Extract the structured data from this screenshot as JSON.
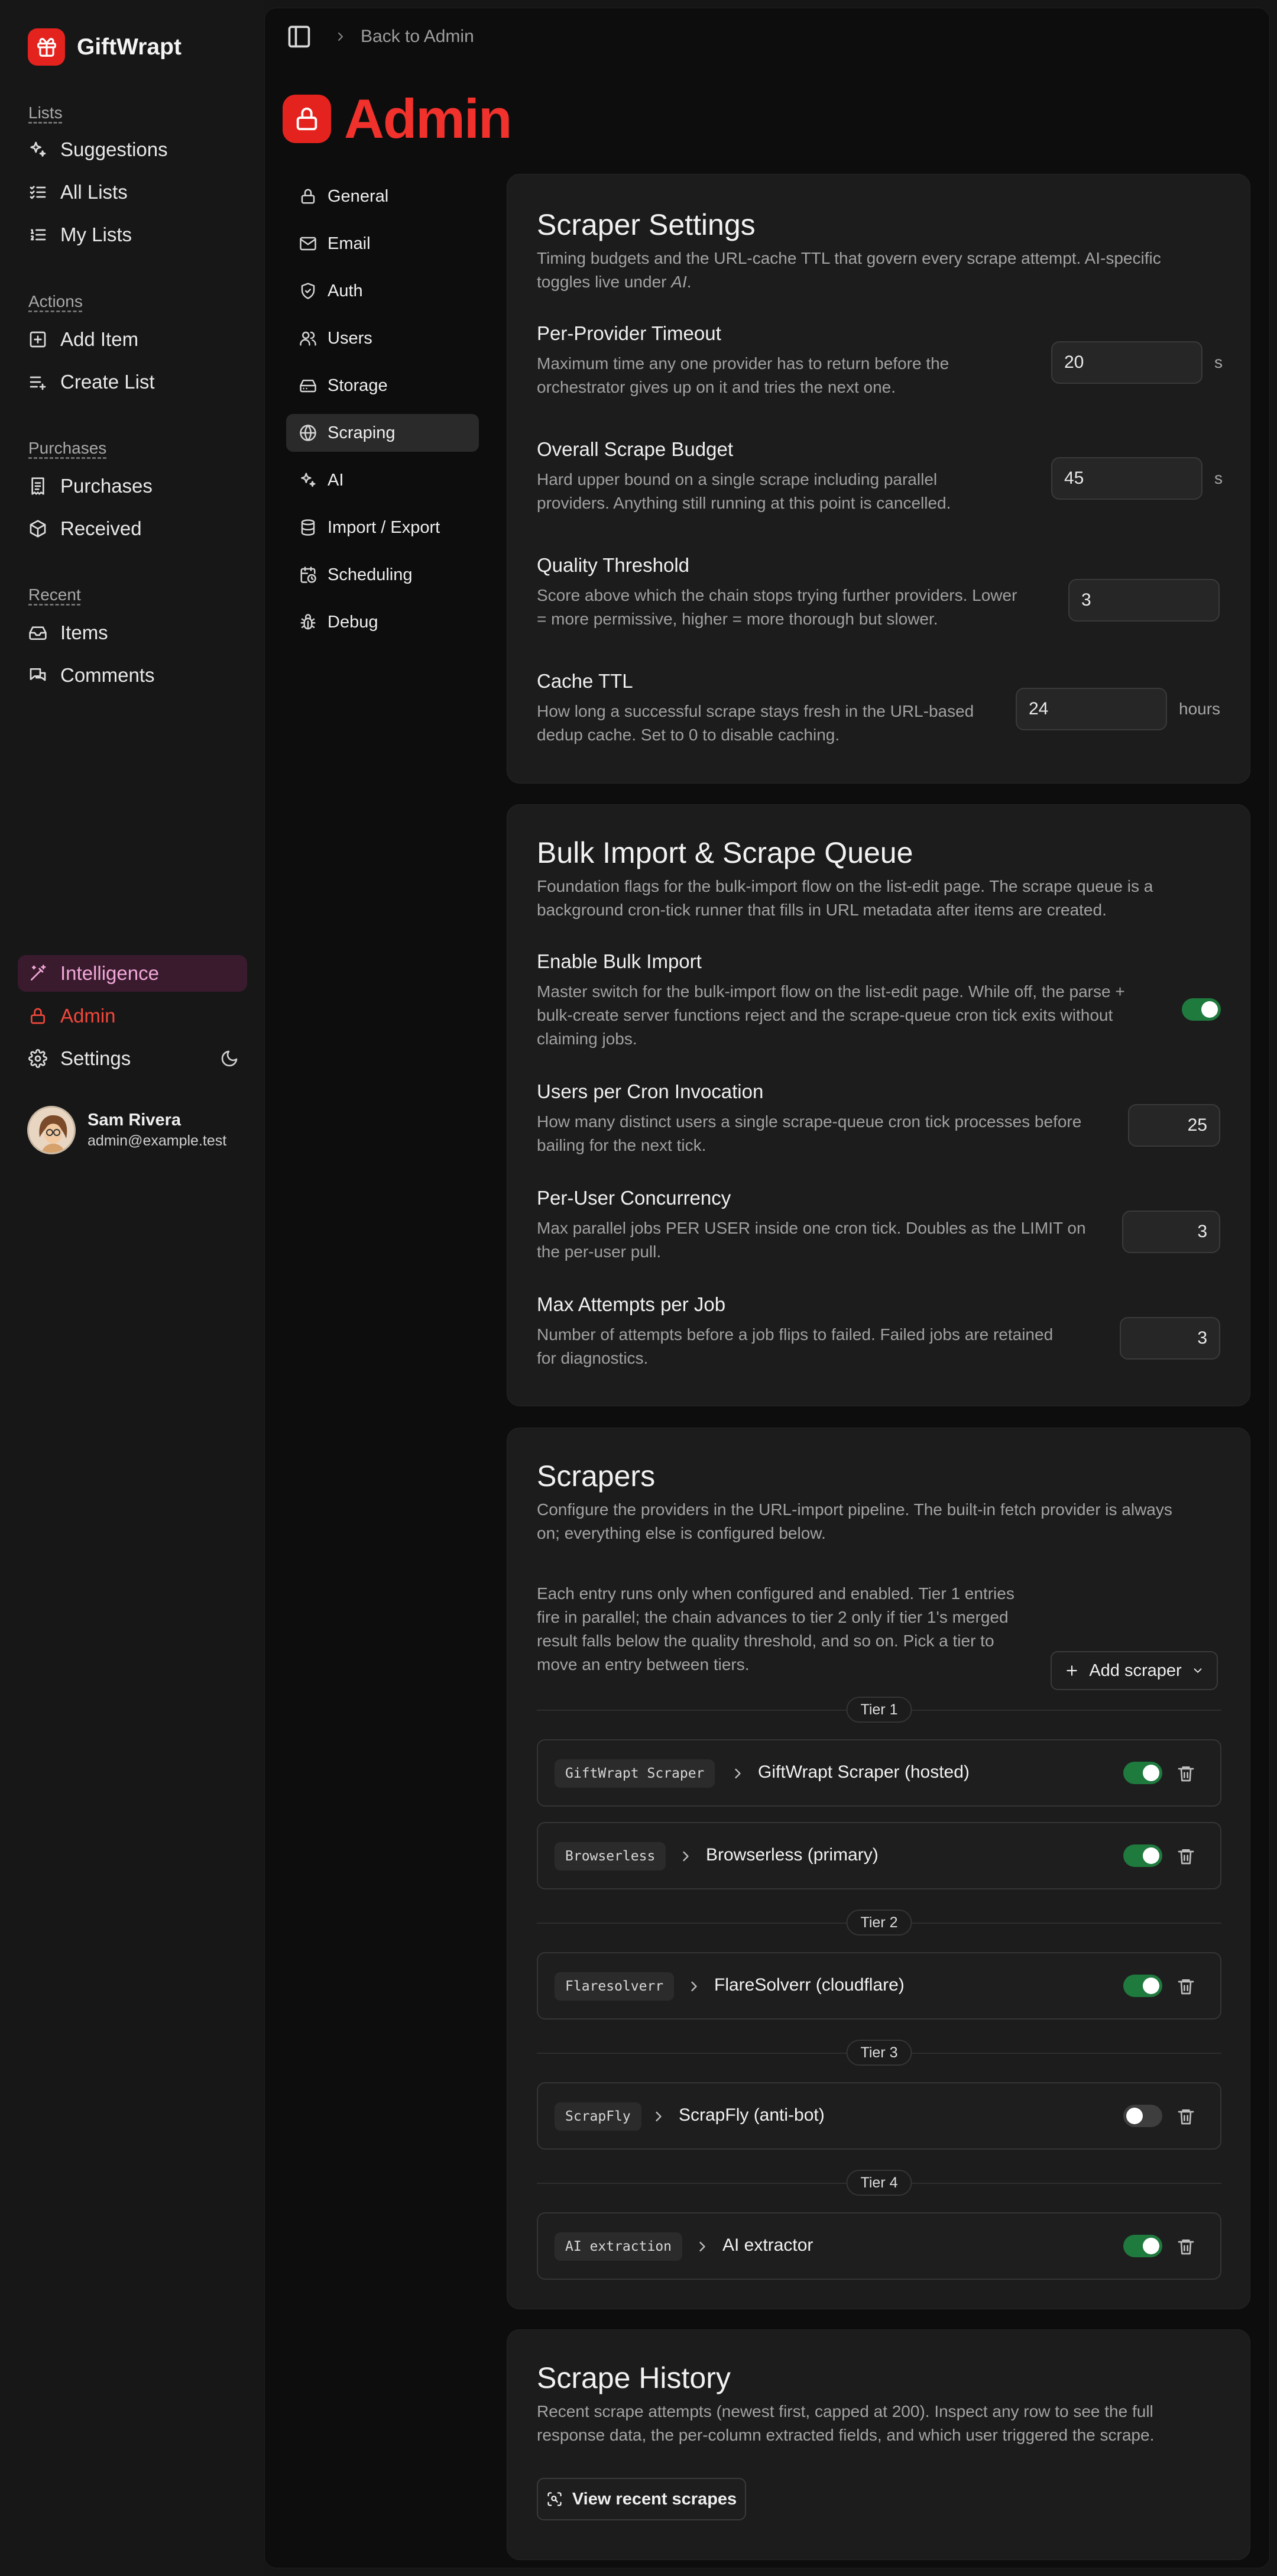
{
  "app": {
    "name": "GiftWrapt"
  },
  "sidebar": {
    "groups": {
      "lists": "Lists",
      "actions": "Actions",
      "purchases": "Purchases",
      "recent": "Recent"
    },
    "items": {
      "suggestions": "Suggestions",
      "all_lists": "All Lists",
      "my_lists": "My Lists",
      "add_item": "Add Item",
      "create_list": "Create List",
      "purchases": "Purchases",
      "received": "Received",
      "items": "Items",
      "comments": "Comments",
      "intelligence": "Intelligence",
      "admin": "Admin",
      "settings": "Settings"
    },
    "user": {
      "name": "Sam Rivera",
      "email": "admin@example.test"
    }
  },
  "header": {
    "breadcrumb": "Back to Admin",
    "title": "Admin"
  },
  "admin_nav": {
    "general": "General",
    "email": "Email",
    "auth": "Auth",
    "users": "Users",
    "storage": "Storage",
    "scraping": "Scraping",
    "ai": "AI",
    "import_export": "Import / Export",
    "scheduling": "Scheduling",
    "debug": "Debug",
    "active": "Scraping"
  },
  "scraper_settings": {
    "title": "Scraper Settings",
    "desc_prefix": "Timing budgets and the URL-cache TTL that govern every scrape attempt. AI-specific toggles live under ",
    "desc_link": "AI",
    "desc_suffix": ".",
    "fields": {
      "timeout": {
        "label": "Per-Provider Timeout",
        "desc1": "Maximum time any one provider has to return before the",
        "desc2": "orchestrator gives up on it and tries the next one.",
        "value": "20",
        "unit": "s"
      },
      "budget": {
        "label": "Overall Scrape Budget",
        "desc1": "Hard upper bound on a single scrape including parallel",
        "desc2": "providers. Anything still running at this point is cancelled.",
        "value": "45",
        "unit": "s"
      },
      "quality": {
        "label": "Quality Threshold",
        "desc1": "Score above which the chain stops trying further providers. Lower",
        "desc2": "= more permissive, higher = more thorough but slower.",
        "value": "3"
      },
      "cache": {
        "label": "Cache TTL",
        "desc1": "How long a successful scrape stays fresh in the URL-based",
        "desc2": "dedup cache. Set to 0 to disable caching.",
        "value": "24",
        "unit": "hours"
      }
    }
  },
  "bulk_import": {
    "title": "Bulk Import & Scrape Queue",
    "desc1": "Foundation flags for the bulk-import flow on the list-edit page. The scrape queue is a",
    "desc2": "background cron-tick runner that fills in URL metadata after items are created.",
    "fields": {
      "enable": {
        "label": "Enable Bulk Import",
        "desc1": "Master switch for the bulk-import flow on the list-edit page. While off, the parse +",
        "desc2": "bulk-create server functions reject and the scrape-queue cron tick exits without",
        "desc3": "claiming jobs.",
        "enabled": true
      },
      "users_per_cron": {
        "label": "Users per Cron Invocation",
        "desc1": "How many distinct users a single scrape-queue cron tick processes before",
        "desc2": "bailing for the next tick.",
        "value": "25"
      },
      "concurrency": {
        "label": "Per-User Concurrency",
        "desc1": "Max parallel jobs PER USER inside one cron tick. Doubles as the LIMIT on",
        "desc2": "the per-user pull.",
        "value": "3"
      },
      "max_attempts": {
        "label": "Max Attempts per Job",
        "desc1": "Number of attempts before a job flips to failed. Failed jobs are retained",
        "desc2": "for diagnostics.",
        "value": "3"
      }
    }
  },
  "scrapers": {
    "title": "Scrapers",
    "desc1": "Configure the providers in the URL-import pipeline. The built-in fetch provider is always",
    "desc2": "on; everything else is configured below.",
    "info1": "Each entry runs only when configured and enabled. Tier 1 entries",
    "info2": "fire in parallel; the chain advances to tier 2 only if tier 1's merged",
    "info3": "result falls below the quality threshold, and so on. Pick a tier to",
    "info4": "move an entry between tiers.",
    "add_label": "Add scraper",
    "tiers": [
      "Tier 1",
      "Tier 2",
      "Tier 3",
      "Tier 4"
    ],
    "entries": [
      {
        "type": "GiftWrapt Scraper",
        "name": "GiftWrapt Scraper (hosted)",
        "enabled": true
      },
      {
        "type": "Browserless",
        "name": "Browserless (primary)",
        "enabled": true
      },
      {
        "type": "Flaresolverr",
        "name": "FlareSolverr (cloudflare)",
        "enabled": true
      },
      {
        "type": "ScrapFly",
        "name": "ScrapFly (anti-bot)",
        "enabled": false
      },
      {
        "type": "AI extraction",
        "name": "AI extractor",
        "enabled": true
      }
    ]
  },
  "history": {
    "title": "Scrape History",
    "desc1": "Recent scrape attempts (newest first, capped at 200). Inspect any row to see the full",
    "desc2": "response data, the per-column extracted fields, and which user triggered the scrape.",
    "button": "View recent scrapes"
  },
  "colors": {
    "brand": "#e5231e",
    "admin_title": "#f0312c",
    "toggle_on": "#1f7a3e",
    "intelligence": "#f0a7d8"
  }
}
